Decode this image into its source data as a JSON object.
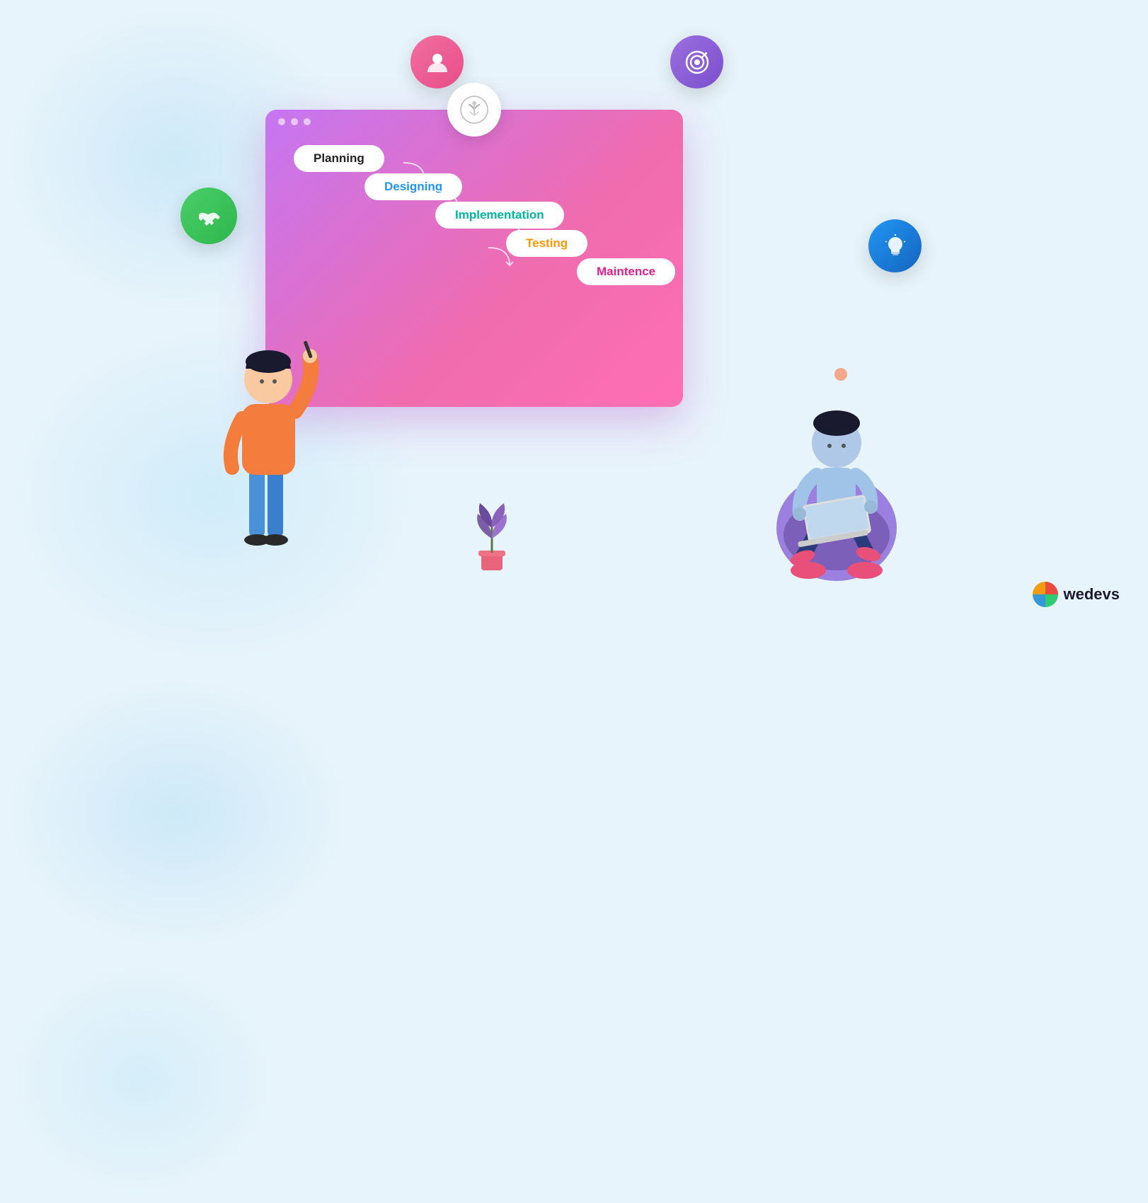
{
  "background": {
    "color": "#e8f4fb"
  },
  "floating_icons": [
    {
      "id": "handshake",
      "label": "handshake-icon",
      "bg": "#2db84b",
      "symbol": "🤝"
    },
    {
      "id": "user",
      "label": "user-icon",
      "bg": "#e94e87",
      "symbol": "👤"
    },
    {
      "id": "target",
      "label": "target-icon",
      "bg": "#7c4fce",
      "symbol": "🎯"
    },
    {
      "id": "lightbulb",
      "label": "lightbulb-icon",
      "bg": "#1565c0",
      "symbol": "💡"
    }
  ],
  "browser": {
    "logo_symbol": "⓪",
    "dots": [
      "dot1",
      "dot2",
      "dot3"
    ]
  },
  "flowchart": {
    "items": [
      {
        "id": "planning",
        "label": "Planning",
        "color": "#222222"
      },
      {
        "id": "designing",
        "label": "Designing",
        "color": "#2196f3"
      },
      {
        "id": "implementation",
        "label": "Implementation",
        "color": "#00b8a0"
      },
      {
        "id": "testing",
        "label": "Testing",
        "color": "#ff9800"
      },
      {
        "id": "maintence",
        "label": "Maintence",
        "color": "#e91e8c"
      }
    ]
  },
  "branding": {
    "name": "wedevs"
  }
}
